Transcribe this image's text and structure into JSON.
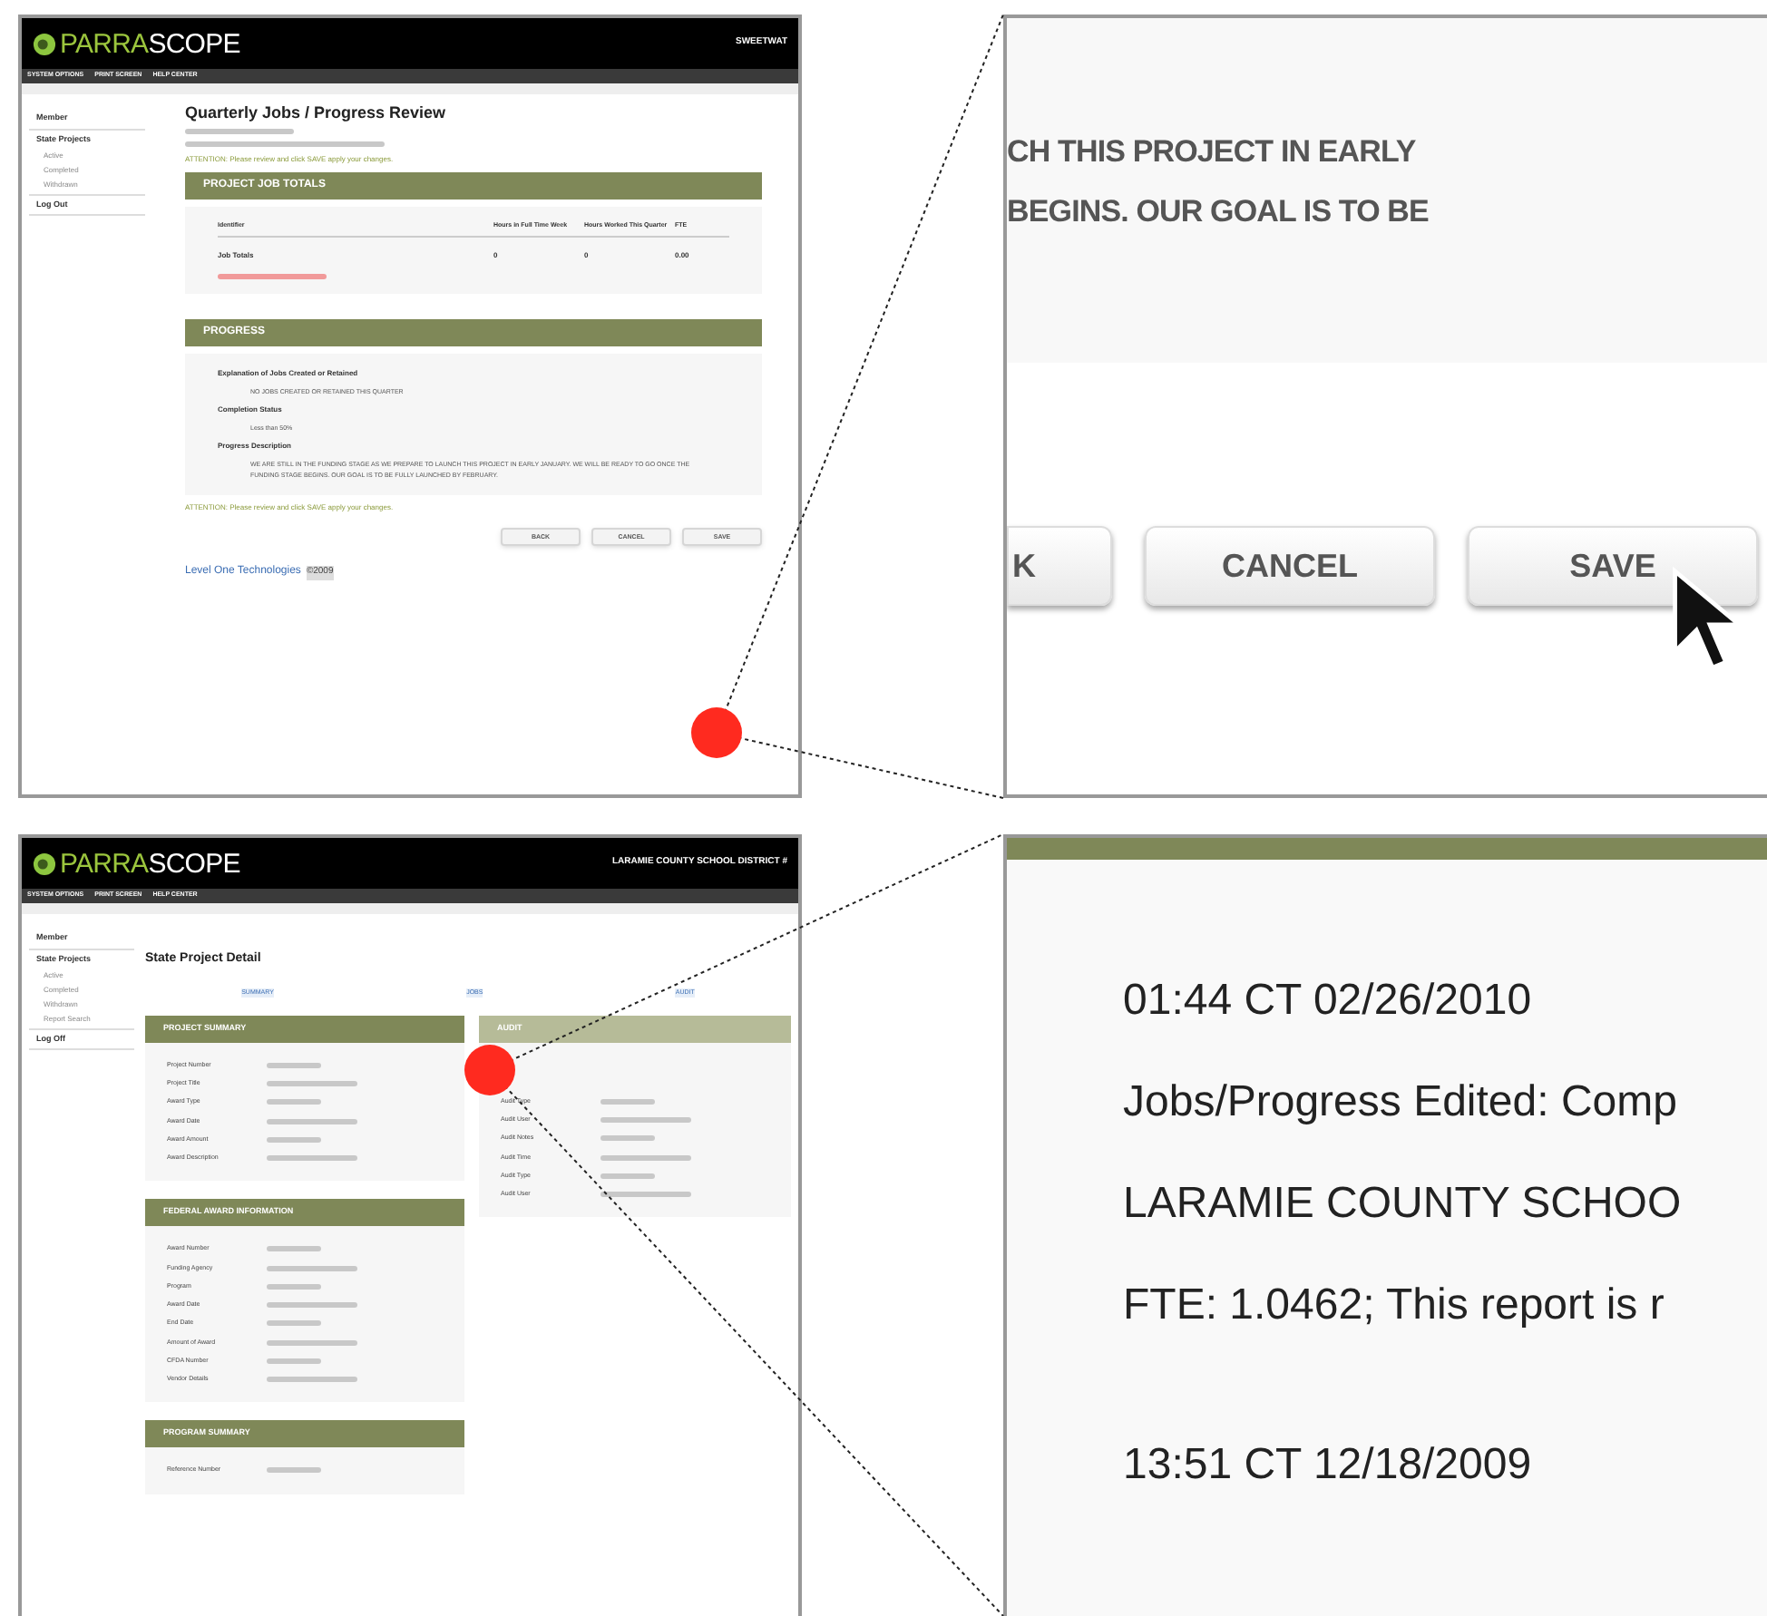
{
  "top_screen": {
    "logo": {
      "first": "PARRA",
      "second": "SCOPE"
    },
    "header_right": "SWEETWAT",
    "nav": [
      "SYSTEM OPTIONS",
      "PRINT SCREEN",
      "HELP CENTER"
    ],
    "sidebar": [
      {
        "label": "Member"
      },
      {
        "label": "State Projects",
        "children": [
          {
            "label": "Active"
          },
          {
            "label": "Completed"
          },
          {
            "label": "Withdrawn"
          }
        ]
      },
      {
        "label": "Log Out"
      }
    ],
    "title": "Quarterly Jobs / Progress Review",
    "attention": "ATTENTION: Please review and click SAVE apply your changes.",
    "job_totals": {
      "title": "PROJECT JOB TOTALS",
      "columns": [
        "Identifier",
        "Hours in Full Time Week",
        "Hours Worked This Quarter",
        "FTE"
      ],
      "rows": [
        [
          "Job Totals",
          "0",
          "0",
          "0.00"
        ]
      ]
    },
    "progress": {
      "title": "PROGRESS",
      "items": [
        {
          "label": "Explanation of Jobs Created or Retained",
          "value": "NO JOBS CREATED OR RETAINED THIS QUARTER"
        },
        {
          "label": "Completion Status",
          "value": "Less than 50%"
        },
        {
          "label": "Progress Description",
          "value": "WE ARE STILL IN THE FUNDING STAGE AS WE PREPARE TO LAUNCH THIS PROJECT IN EARLY JANUARY. WE WILL BE READY TO GO ONCE THE FUNDING STAGE BEGINS. OUR GOAL IS TO BE FULLY LAUNCHED BY FEBRUARY."
        }
      ]
    },
    "attention_bottom": "ATTENTION: Please review and click SAVE apply your changes.",
    "buttons": [
      "BACK",
      "CANCEL",
      "SAVE"
    ],
    "footer": {
      "link": "Level One Technologies",
      "year": "©2009"
    }
  },
  "bottom_screen": {
    "logo": {
      "first": "PARRA",
      "second": "SCOPE"
    },
    "header_right": "LARAMIE COUNTY SCHOOL DISTRICT #",
    "nav": [
      "SYSTEM OPTIONS",
      "PRINT SCREEN",
      "HELP CENTER"
    ],
    "sidebar": [
      {
        "label": "Member"
      },
      {
        "label": "State Projects",
        "children": [
          {
            "label": "Active"
          },
          {
            "label": "Completed"
          },
          {
            "label": "Withdrawn"
          },
          {
            "label": "Report Search"
          }
        ]
      },
      {
        "label": "Log Off"
      }
    ],
    "title": "State Project Detail",
    "links": [
      "SUMMARY",
      "JOBS",
      "AUDIT"
    ],
    "sections": [
      {
        "title": "PROJECT SUMMARY",
        "rows": [
          "Project Number",
          "Project Title",
          "Award Type",
          "Award Date",
          "Award Amount",
          "Award Description"
        ]
      },
      {
        "title": "FEDERAL AWARD INFORMATION",
        "rows": [
          "Award Number",
          "Funding Agency",
          "Program",
          "Award Date",
          "End Date",
          "Amount of Award",
          "CFDA Number",
          "Vendor Details"
        ]
      },
      {
        "title": "PROGRAM SUMMARY",
        "rows": [
          "Reference Number"
        ]
      }
    ],
    "audit": {
      "title": "AUDIT",
      "rows": [
        "Audit Type",
        "Audit User",
        "Audit Notes",
        "Audit Time",
        "Audit Type",
        "Audit User"
      ]
    }
  },
  "zoom_top": {
    "lines": [
      "CH THIS PROJECT IN EARLY",
      "BEGINS. OUR GOAL IS TO BE"
    ],
    "buttons": [
      "K",
      "CANCEL",
      "SAVE"
    ]
  },
  "zoom_bottom": {
    "entries": [
      {
        "lines": [
          "01:44 CT 02/26/2010",
          "Jobs/Progress Edited: Comp",
          "LARAMIE COUNTY SCHOO",
          "FTE: 1.0462; This report is r"
        ]
      },
      {
        "lines": [
          "13:51 CT 12/18/2009"
        ]
      }
    ]
  }
}
